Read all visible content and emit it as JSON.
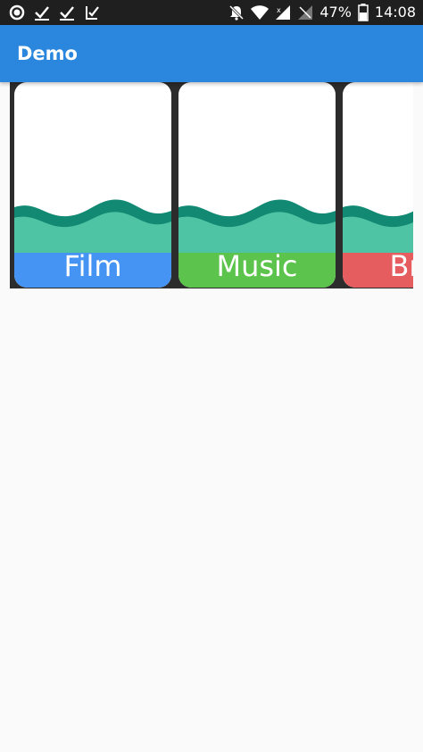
{
  "status_bar": {
    "battery_percent": "47%",
    "time": "14:08",
    "icons": [
      "circle-icon",
      "check-icon",
      "check-icon",
      "task-icon",
      "mute-icon",
      "wifi-icon",
      "signal-icon",
      "no-signal-icon",
      "battery-icon"
    ]
  },
  "app_bar": {
    "title": "Demo",
    "color": "#2a87dd"
  },
  "carousel": {
    "cards": [
      {
        "label": "Film",
        "color": "#4593f3"
      },
      {
        "label": "Music",
        "color": "#5cc44c"
      },
      {
        "label": "Br",
        "color": "#e65d5f"
      }
    ],
    "wave_dark": "#128a73",
    "wave_light": "#4fc4a4"
  }
}
